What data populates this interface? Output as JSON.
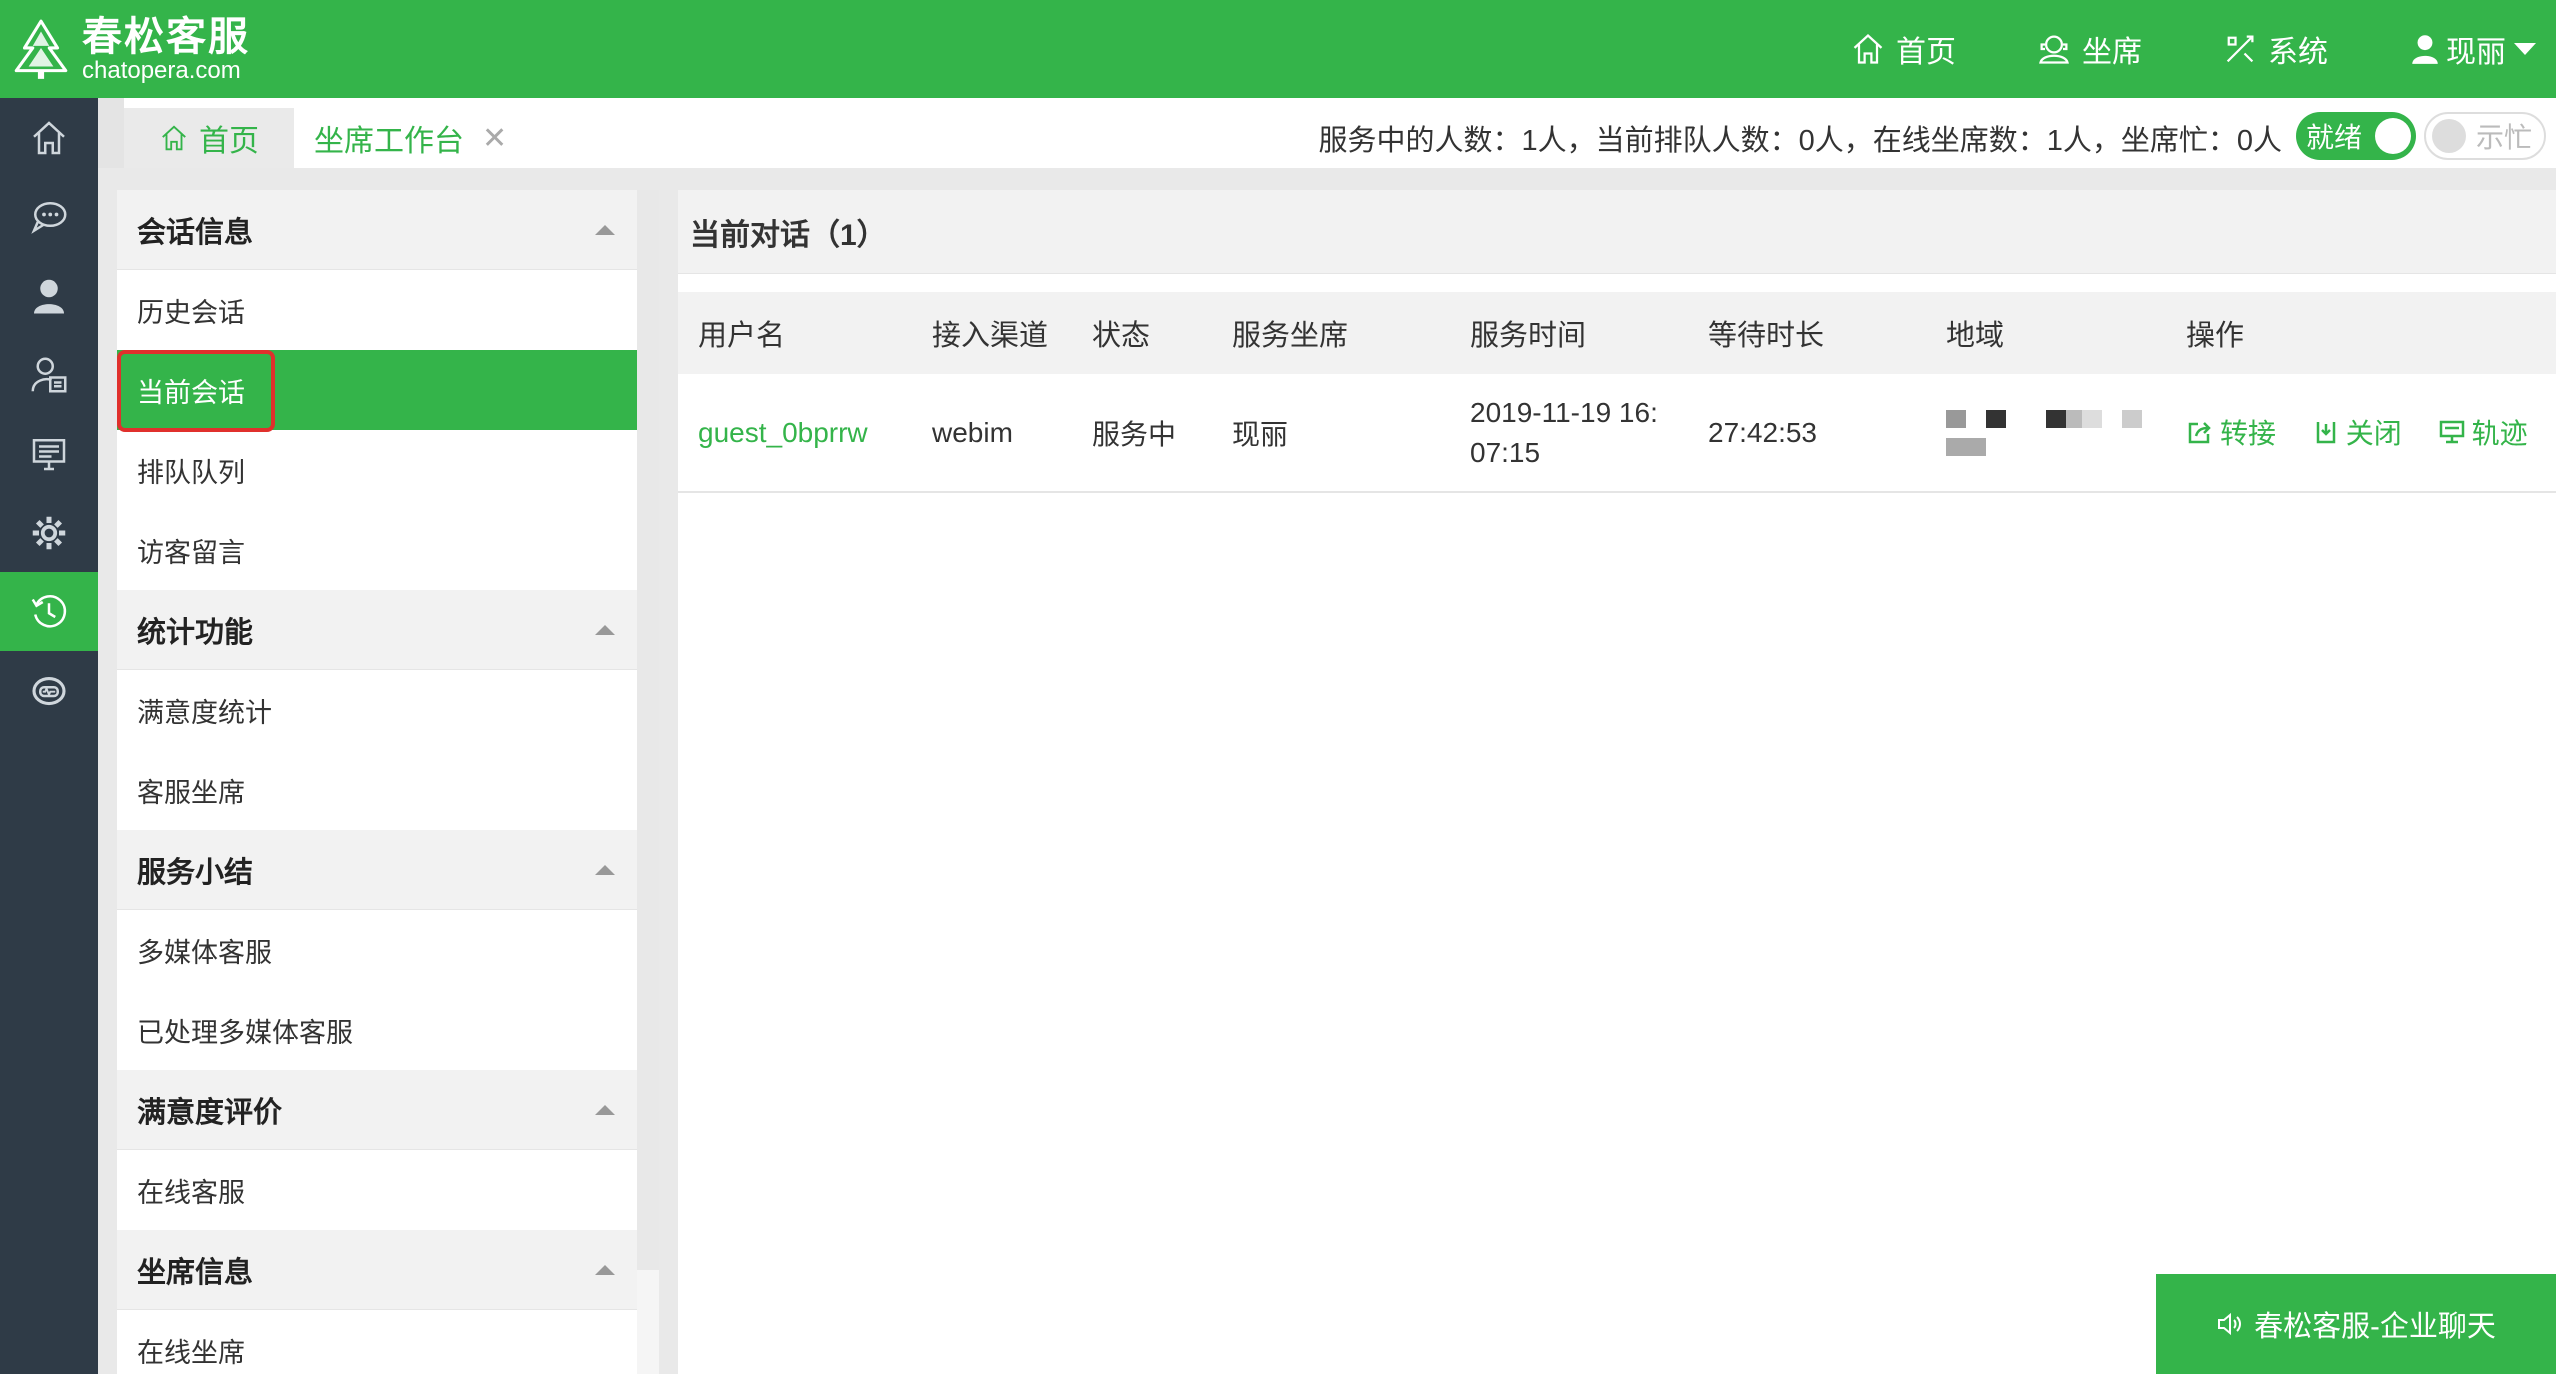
{
  "header": {
    "logo_cn": "春松客服",
    "logo_en": "chatopera.com",
    "nav": [
      {
        "label": "首页",
        "icon": "home-icon"
      },
      {
        "label": "坐席",
        "icon": "agent-icon"
      },
      {
        "label": "系统",
        "icon": "tools-icon"
      }
    ],
    "user_name": "现丽",
    "brand_color": "#34b44a"
  },
  "leftbar": {
    "items": [
      "home-icon",
      "chat-icon",
      "user-icon",
      "contacts-icon",
      "monitor-icon",
      "gear-icon",
      "history-icon",
      "robot-icon"
    ],
    "active_index": 6
  },
  "tabs": {
    "home_label": "首页",
    "workbench_label": "坐席工作台",
    "close_glyph": "✕"
  },
  "status": {
    "text": "服务中的人数：1人，当前排队人数：0人，在线坐席数：1人，坐席忙：0人",
    "ready_label": "就绪",
    "busy_label": "示忙"
  },
  "sidemenu": {
    "groups": [
      {
        "title": "会话信息",
        "items": [
          "历史会话",
          "当前会话",
          "排队队列",
          "访客留言"
        ]
      },
      {
        "title": "统计功能",
        "items": [
          "满意度统计",
          "客服坐席"
        ]
      },
      {
        "title": "服务小结",
        "items": [
          "多媒体客服",
          "已处理多媒体客服"
        ]
      },
      {
        "title": "满意度评价",
        "items": [
          "在线客服"
        ]
      },
      {
        "title": "坐席信息",
        "items": [
          "在线坐席"
        ]
      }
    ],
    "active_item": "当前会话"
  },
  "content": {
    "title": "当前对话（1）",
    "columns": [
      "用户名",
      "接入渠道",
      "状态",
      "服务坐席",
      "服务时间",
      "等待时长",
      "地域",
      "操作"
    ],
    "rows": [
      {
        "username": "guest_0bprrw",
        "channel": "webim",
        "status": "服务中",
        "agent": "现丽",
        "service_time_line1": "2019-11-19 16:",
        "service_time_line2": "07:15",
        "wait_duration": "27:42:53",
        "actions": {
          "transfer": "转接",
          "close": "关闭",
          "track": "轨迹"
        }
      }
    ]
  },
  "chatbar": {
    "label": "春松客服-企业聊天"
  }
}
